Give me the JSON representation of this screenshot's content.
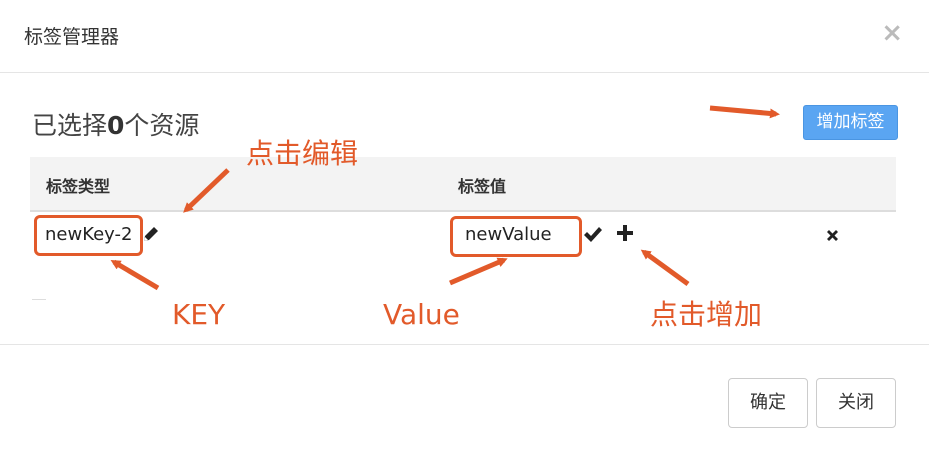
{
  "dialog": {
    "title": "标签管理器",
    "close_label": "×"
  },
  "selection": {
    "prefix": "已选择",
    "count": "0",
    "suffix": "个资源"
  },
  "toolbar": {
    "add_tag_label": "增加标签"
  },
  "table": {
    "columns": [
      "标签类型",
      "标签值"
    ],
    "rows": [
      {
        "key": "newKey-2",
        "value": "newValue"
      }
    ]
  },
  "footer": {
    "confirm_label": "确定",
    "close_label": "关闭"
  },
  "annotations": {
    "click_edit": "点击编辑",
    "key": "KEY",
    "value": "Value",
    "click_add": "点击增加"
  },
  "colors": {
    "accent": "#5aa5f2",
    "annotation": "#e25a2a"
  }
}
